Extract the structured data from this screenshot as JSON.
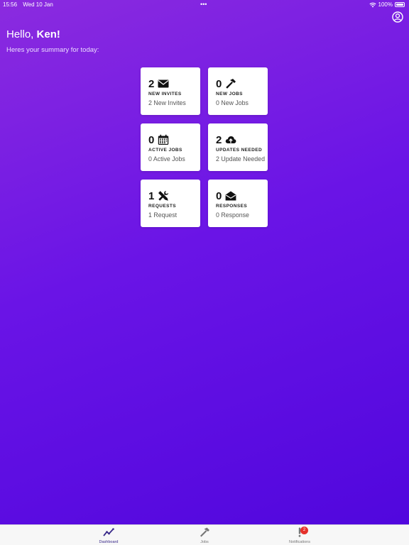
{
  "status_bar": {
    "time": "15:56",
    "date": "Wed 10 Jan",
    "dots": "•••",
    "battery": "100%"
  },
  "header": {
    "greeting_prefix": "Hello,",
    "user_name": "Ken!",
    "subtitle": "Heres your summary for today:"
  },
  "cards": [
    {
      "count": "2",
      "label": "NEW INVITES",
      "sub": "2 New Invites",
      "icon": "envelope-icon"
    },
    {
      "count": "0",
      "label": "NEW JOBS",
      "sub": "0 New Jobs",
      "icon": "hammer-icon"
    },
    {
      "count": "0",
      "label": "ACTIVE JOBS",
      "sub": "0 Active Jobs",
      "icon": "calendar-icon"
    },
    {
      "count": "2",
      "label": "UPDATES NEEDED",
      "sub": "2 Update Needed",
      "icon": "cloud-upload-icon"
    },
    {
      "count": "1",
      "label": "REQUESTS",
      "sub": "1 Request",
      "icon": "tools-icon"
    },
    {
      "count": "0",
      "label": "RESPONSES",
      "sub": "0 Response",
      "icon": "envelope-open-icon"
    }
  ],
  "tabs": [
    {
      "label": "Dashboard",
      "icon": "chart-line-icon",
      "active": true
    },
    {
      "label": "Jobs",
      "icon": "hammer-icon",
      "active": false
    },
    {
      "label": "Notifications",
      "icon": "exclamation-icon",
      "active": false,
      "badge": "2"
    }
  ],
  "colors": {
    "gradient_start": "#8b2bdf",
    "gradient_end": "#4f06dd",
    "badge": "#e5312b",
    "active_tab": "#3a2a8a"
  }
}
